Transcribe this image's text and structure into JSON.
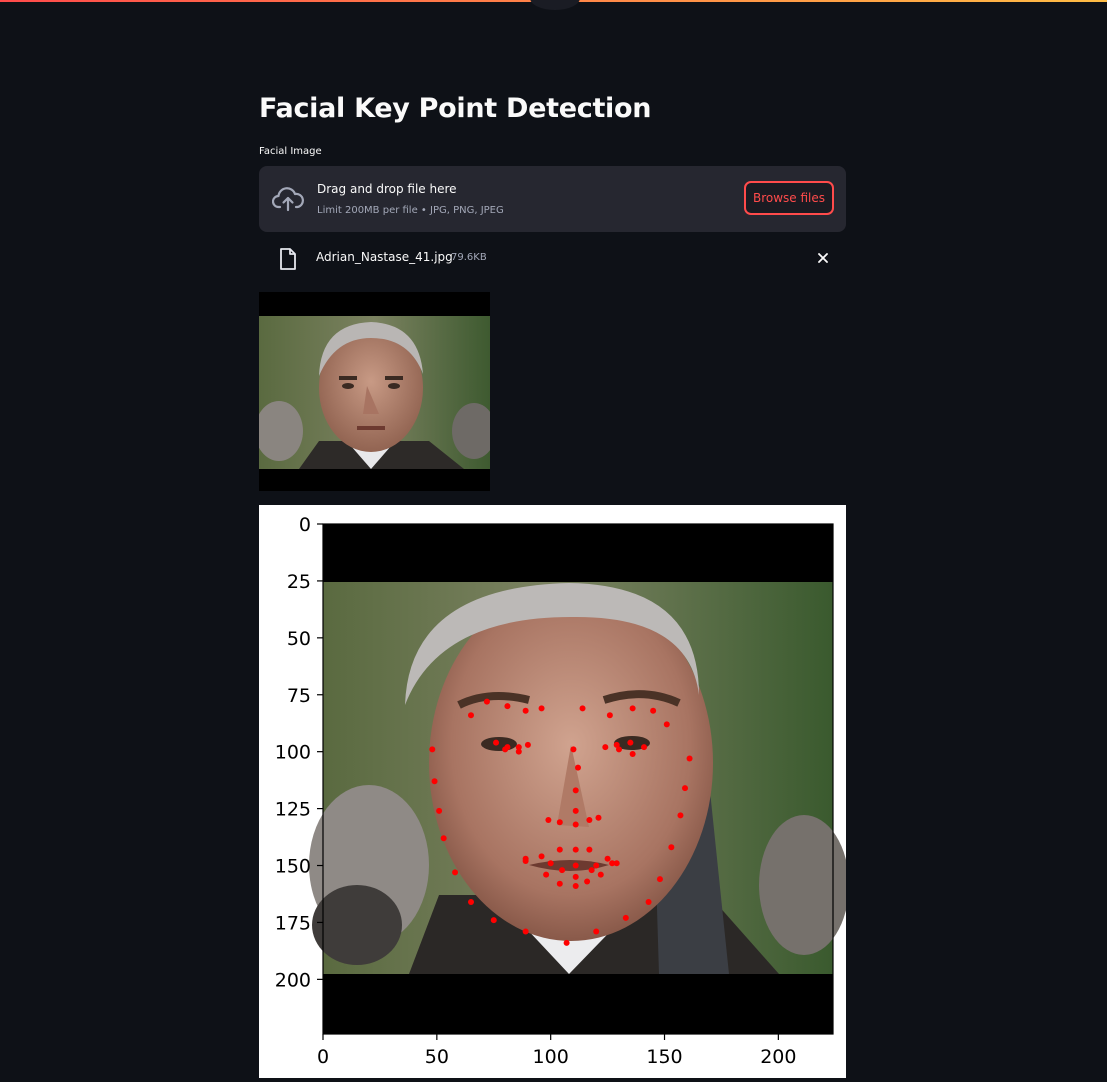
{
  "app": {
    "title": "Facial Key Point Detection",
    "accent_color": "#ff4b4b",
    "background_color": "#0e1117"
  },
  "uploader": {
    "label": "Facial Image",
    "drop_text": "Drag and drop file here",
    "limit_text": "Limit 200MB per file • JPG, PNG, JPEG",
    "browse_label": "Browse files",
    "icon": "cloud-upload-icon"
  },
  "uploaded_file": {
    "name": "Adrian_Nastase_41.jpg",
    "size": "79.6KB",
    "icon": "file-icon",
    "remove_icon": "close-icon"
  },
  "thumbnail": {
    "description": "uploaded face photo"
  },
  "chart_data": {
    "type": "scatter",
    "title": "",
    "xlabel": "",
    "ylabel": "",
    "xlim": [
      0,
      224
    ],
    "ylim": [
      224,
      0
    ],
    "xticks": [
      0,
      50,
      100,
      150,
      200
    ],
    "yticks": [
      0,
      25,
      50,
      75,
      100,
      125,
      150,
      175,
      200
    ],
    "background": "face image 224x224 with black bars top and bottom",
    "marker_color": "#ff0000",
    "series": [
      {
        "x": [
          48,
          49,
          51,
          53,
          58,
          65,
          75,
          89,
          107,
          120,
          133,
          143,
          148,
          153,
          157,
          159,
          161,
          65,
          72,
          81,
          89,
          96,
          114,
          126,
          136,
          145,
          151,
          110,
          112,
          111,
          111,
          99,
          104,
          111,
          117,
          121,
          76,
          80,
          86,
          90,
          86,
          81,
          124,
          129,
          135,
          141,
          136,
          130,
          89,
          96,
          104,
          111,
          117,
          125,
          129,
          122,
          116,
          111,
          104,
          98,
          89,
          100,
          111,
          120,
          127,
          118,
          111,
          105
        ],
        "y": [
          99,
          113,
          126,
          138,
          153,
          166,
          174,
          179,
          184,
          179,
          173,
          166,
          156,
          142,
          128,
          116,
          103,
          84,
          78,
          80,
          82,
          81,
          81,
          84,
          81,
          82,
          88,
          99,
          107,
          117,
          126,
          130,
          131,
          132,
          130,
          129,
          96,
          99,
          98,
          97,
          100,
          98,
          98,
          97,
          96,
          98,
          101,
          99,
          147,
          146,
          143,
          143,
          143,
          147,
          149,
          154,
          157,
          159,
          158,
          154,
          148,
          149,
          150,
          150,
          149,
          152,
          155,
          152
        ]
      }
    ]
  }
}
